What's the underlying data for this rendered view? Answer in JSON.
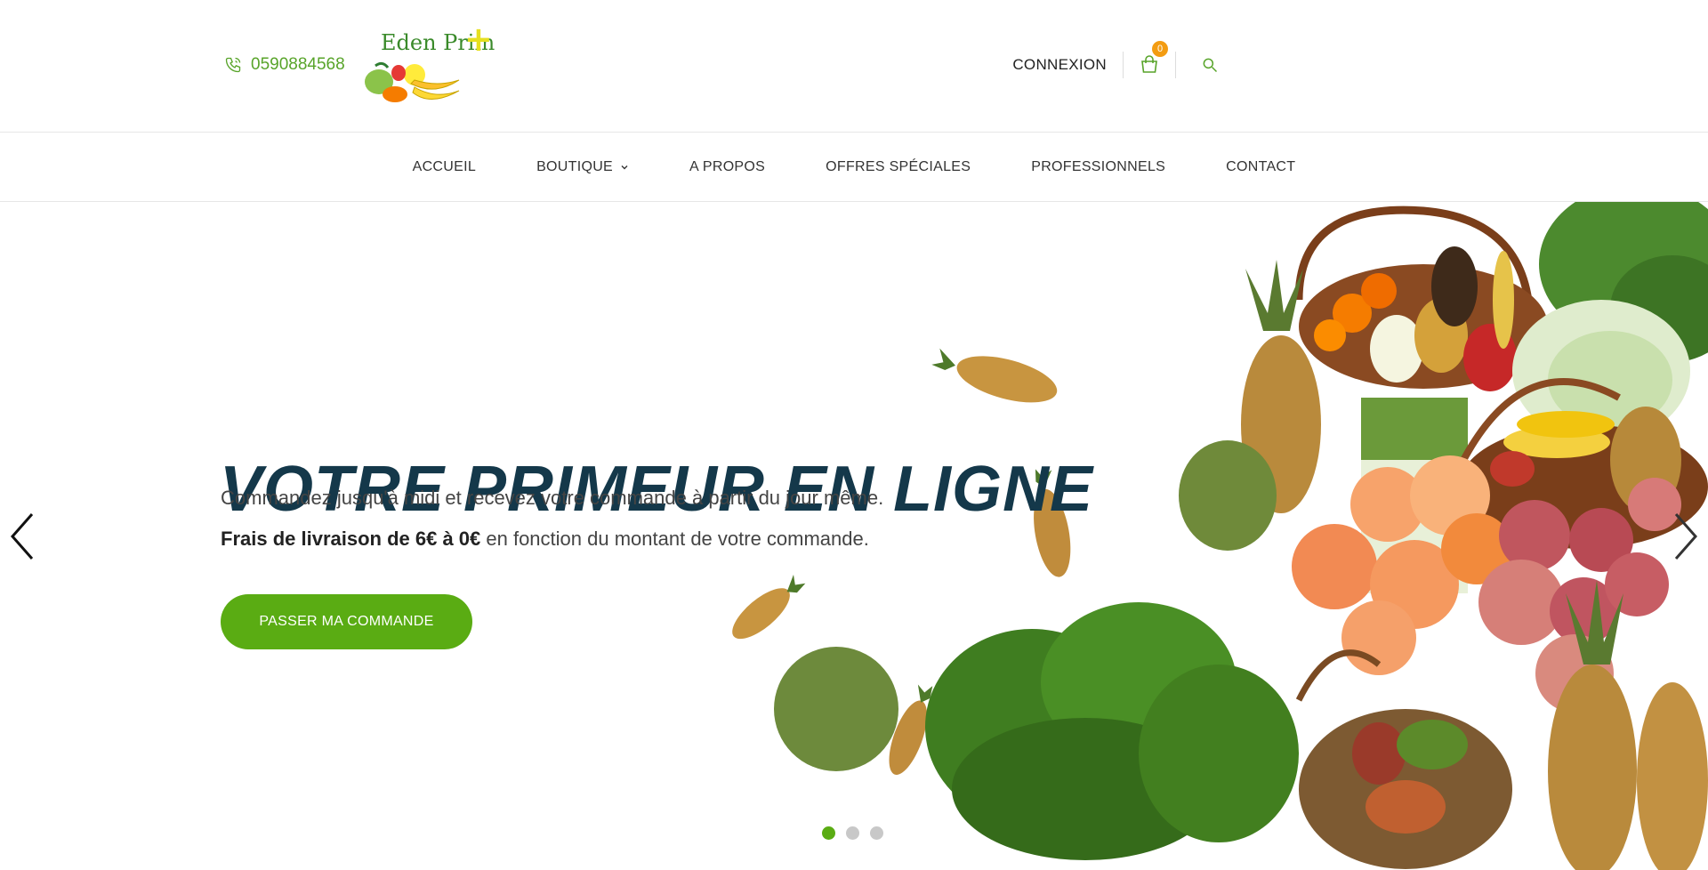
{
  "header": {
    "phone": "0590884568",
    "logo": {
      "name": "Eden Prim",
      "plus": "+"
    },
    "connexion_label": "CONNEXION",
    "cart_count": "0"
  },
  "nav": {
    "items": [
      "ACCUEIL",
      "BOUTIQUE",
      "A PROPOS",
      "OFFRES SPÉCIALES",
      "PROFESSIONNELS",
      "CONTACT"
    ]
  },
  "hero": {
    "title": "VOTRE PRIMEUR EN LIGNE",
    "subtitle": "Commandez jusqu'à midi et recevez votre commande à partir du jour même.",
    "shipping_bold": "Frais de livraison de 6€ à 0€",
    "shipping_rest": " en fonction du montant de votre commande.",
    "cta_label": "PASSER MA COMMANDE",
    "slides_count": 3,
    "active_slide": 1
  },
  "colors": {
    "brand_green": "#5aac13",
    "title_navy": "#14384a",
    "badge_orange": "#f39c12"
  },
  "icons": [
    "phone-icon",
    "cart-icon",
    "search-icon",
    "chevron-down-icon",
    "arrow-left-icon",
    "arrow-right-icon"
  ]
}
